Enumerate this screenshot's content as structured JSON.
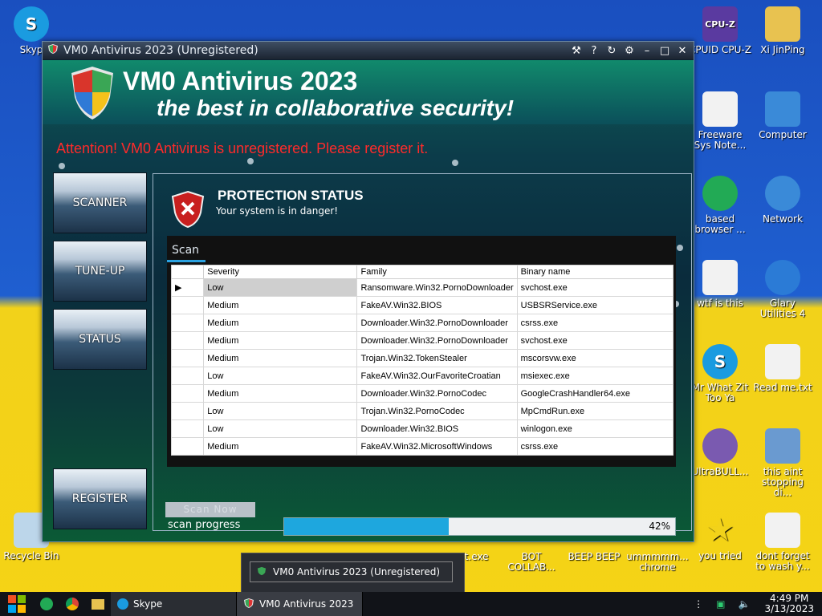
{
  "desktop_icons": [
    {
      "label": "Skyp",
      "icon": "skype-icon",
      "color": "#1a9be0"
    },
    {
      "label": "CPUID CPU-Z",
      "icon": "cpuz-icon",
      "color": "#5a3aa0"
    },
    {
      "label": "Xi JinPing",
      "icon": "folder-icon",
      "color": "#e8c250"
    },
    {
      "label": "Freeware Sys Note...",
      "icon": "document-icon",
      "color": "#f2f2f2"
    },
    {
      "label": "Computer",
      "icon": "computer-icon",
      "color": "#3a8ad8"
    },
    {
      "label": "based browser ...",
      "icon": "browser-icon",
      "color": "#22aa55"
    },
    {
      "label": "Network",
      "icon": "network-icon",
      "color": "#3a8ad8"
    },
    {
      "label": "wtf is this",
      "icon": "document-icon",
      "color": "#f2f2f2"
    },
    {
      "label": "Glary Utilities 4",
      "icon": "glary-icon",
      "color": "#2b7bd6"
    },
    {
      "label": "Mr What Zit Too Ya",
      "icon": "skype-icon",
      "color": "#1a9be0"
    },
    {
      "label": "Read me.txt",
      "icon": "text-file-icon",
      "color": "#f2f2f2"
    },
    {
      "label": "UltraBULL...",
      "icon": "disc-icon",
      "color": "#7a5ab0"
    },
    {
      "label": "this aint stopping di...",
      "icon": "installer-icon",
      "color": "#6a9ad0"
    },
    {
      "label": "you tried",
      "icon": "star-icon",
      "color": "#f2d21a"
    },
    {
      "label": "dont forget to wash y...",
      "icon": "document-icon",
      "color": "#f2f2f2"
    },
    {
      "label": "Recycle Bin",
      "icon": "recycle-bin-icon",
      "color": "#bcd6ea"
    },
    {
      "label": "at.exe",
      "icon": "app-icon",
      "color": "#333"
    },
    {
      "label": "BOT COLLAB...",
      "icon": "app-icon",
      "color": "#333"
    },
    {
      "label": "BEEP BEEP",
      "icon": "app-icon",
      "color": "#333"
    },
    {
      "label": "ummmmm... chrome",
      "icon": "app-icon",
      "color": "#333"
    }
  ],
  "window": {
    "title": "VM0 Antivirus 2023 (Unregistered)"
  },
  "app": {
    "brand": "VM0 Antivirus 2023",
    "tagline": "the best in collaborative security!",
    "attention": "Attention! VM0 Antivirus is unregistered. Please register it.",
    "nav": {
      "scanner": "SCANNER",
      "tuneup": "TUNE-UP",
      "status": "STATUS",
      "register": "REGISTER"
    },
    "protection_title": "PROTECTION STATUS",
    "protection_sub": "Your system is in danger!",
    "scan_tab": "Scan",
    "columns": [
      "Severity",
      "Family",
      "Binary name"
    ],
    "rows": [
      {
        "severity": "Low",
        "family": "Ransomware.Win32.PornoDownloader",
        "binary": "svchost.exe"
      },
      {
        "severity": "Medium",
        "family": "FakeAV.Win32.BIOS",
        "binary": "USBSRService.exe"
      },
      {
        "severity": "Medium",
        "family": "Downloader.Win32.PornoDownloader",
        "binary": "csrss.exe"
      },
      {
        "severity": "Medium",
        "family": "Downloader.Win32.PornoDownloader",
        "binary": "svchost.exe"
      },
      {
        "severity": "Medium",
        "family": "Trojan.Win32.TokenStealer",
        "binary": "mscorsvw.exe"
      },
      {
        "severity": "Low",
        "family": "FakeAV.Win32.OurFavoriteCroatian",
        "binary": "msiexec.exe"
      },
      {
        "severity": "Medium",
        "family": "Downloader.Win32.PornoCodec",
        "binary": "GoogleCrashHandler64.exe"
      },
      {
        "severity": "Low",
        "family": "Trojan.Win32.PornoCodec",
        "binary": "MpCmdRun.exe"
      },
      {
        "severity": "Low",
        "family": "Downloader.Win32.BIOS",
        "binary": "winlogon.exe"
      },
      {
        "severity": "Medium",
        "family": "FakeAV.Win32.MicrosoftWindows",
        "binary": "csrss.exe"
      }
    ],
    "scan_now": "Scan Now",
    "scan_progress_label": "scan progress",
    "progress_value": 42,
    "progress_text": "42%"
  },
  "taskbar": {
    "tasks": [
      {
        "label": "Skype",
        "icon": "skype-icon"
      },
      {
        "label": "VM0 Antivirus 2023",
        "icon": "shield-icon"
      }
    ],
    "preview_label": "VM0 Antivirus 2023 (Unregistered)",
    "time": "4:49 PM",
    "date": "3/13/2023"
  },
  "colors": {
    "attention_red": "#ff2a2a",
    "progress_blue": "#1ea7de",
    "desktop_blue": "#1f5fd0",
    "desktop_yellow": "#f2d21a"
  }
}
